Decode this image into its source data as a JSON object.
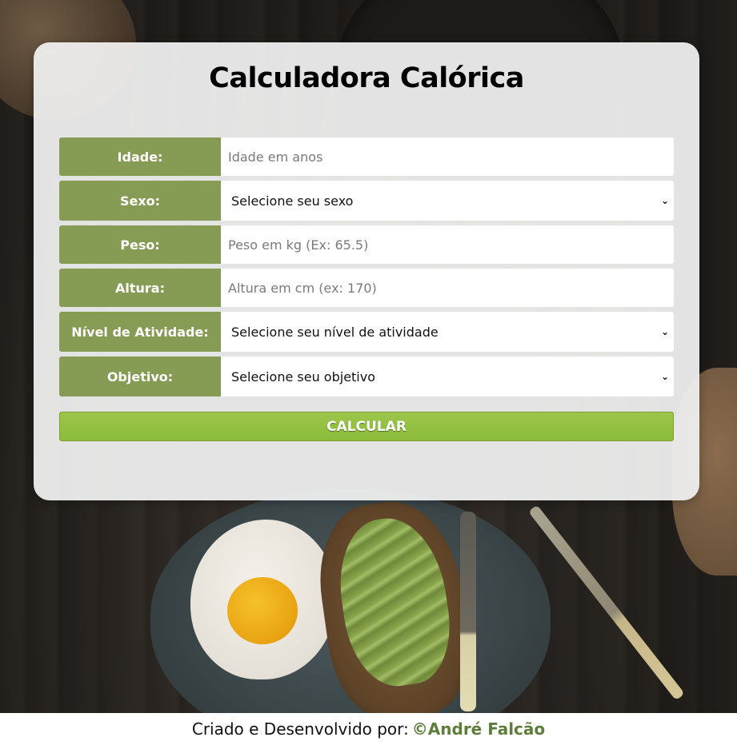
{
  "app": {
    "title": "Calculadora Calórica"
  },
  "form": {
    "fields": [
      {
        "label": "Idade:",
        "type": "input",
        "placeholder": "Idade em anos",
        "value": ""
      },
      {
        "label": "Sexo:",
        "type": "select",
        "selected": "Selecione seu sexo"
      },
      {
        "label": "Peso:",
        "type": "input",
        "placeholder": "Peso em kg (Ex: 65.5)",
        "value": ""
      },
      {
        "label": "Altura:",
        "type": "input",
        "placeholder": "Altura em cm (ex: 170)",
        "value": ""
      },
      {
        "label": "Nível de Atividade:",
        "type": "select",
        "selected": "Selecione seu nível de atividade"
      },
      {
        "label": "Objetivo:",
        "type": "select",
        "selected": "Selecione seu objetivo"
      }
    ],
    "submit_label": "CALCULAR"
  },
  "footer": {
    "text": "Criado e Desenvolvido por:",
    "author": "©André Falcão"
  },
  "icons": {
    "select_chevron": "chevron-down-icon"
  },
  "colors": {
    "label_bg": "#869b54",
    "button_bg": "#8cbb3b",
    "author": "#5e7d3a"
  }
}
